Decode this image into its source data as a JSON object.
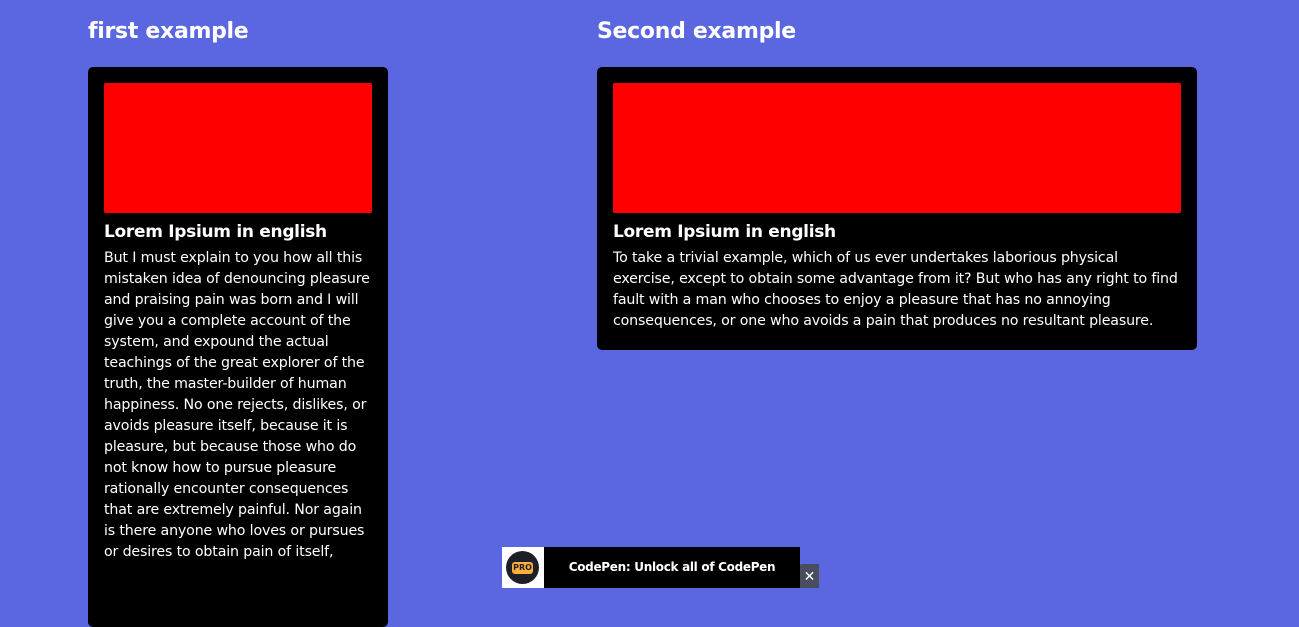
{
  "colors": {
    "background": "#5a67e0",
    "card_background": "#000000",
    "card_image": "#ff0000",
    "text": "#ffffff",
    "pro_badge": "#ffb03b"
  },
  "examples": [
    {
      "heading": "first example",
      "card": {
        "title": "Lorem Ipsium in english",
        "body": "But I must explain to you how all this mistaken idea of denouncing pleasure and praising pain was born and I will give you a complete account of the system, and expound the actual teachings of the great explorer of the truth, the master-builder of human happiness. No one rejects, dislikes, or avoids pleasure itself, because it is pleasure, but because those who do not know how to pursue pleasure rationally encounter consequences that are extremely painful. Nor again is there anyone who loves or pursues or desires to obtain pain of itself,"
      }
    },
    {
      "heading": "Second example",
      "card": {
        "title": "Lorem Ipsium in english",
        "body": "To take a trivial example, which of us ever undertakes laborious physical exercise, except to obtain some advantage from it? But who has any right to find fault with a man who chooses to enjoy a pleasure that has no annoying consequences, or one who avoids a pain that produces no resultant pleasure."
      }
    }
  ],
  "banner": {
    "badge_label": "PRO",
    "text": "CodePen: Unlock all of CodePen",
    "close_icon": "close-icon",
    "close_glyph": "✕"
  }
}
